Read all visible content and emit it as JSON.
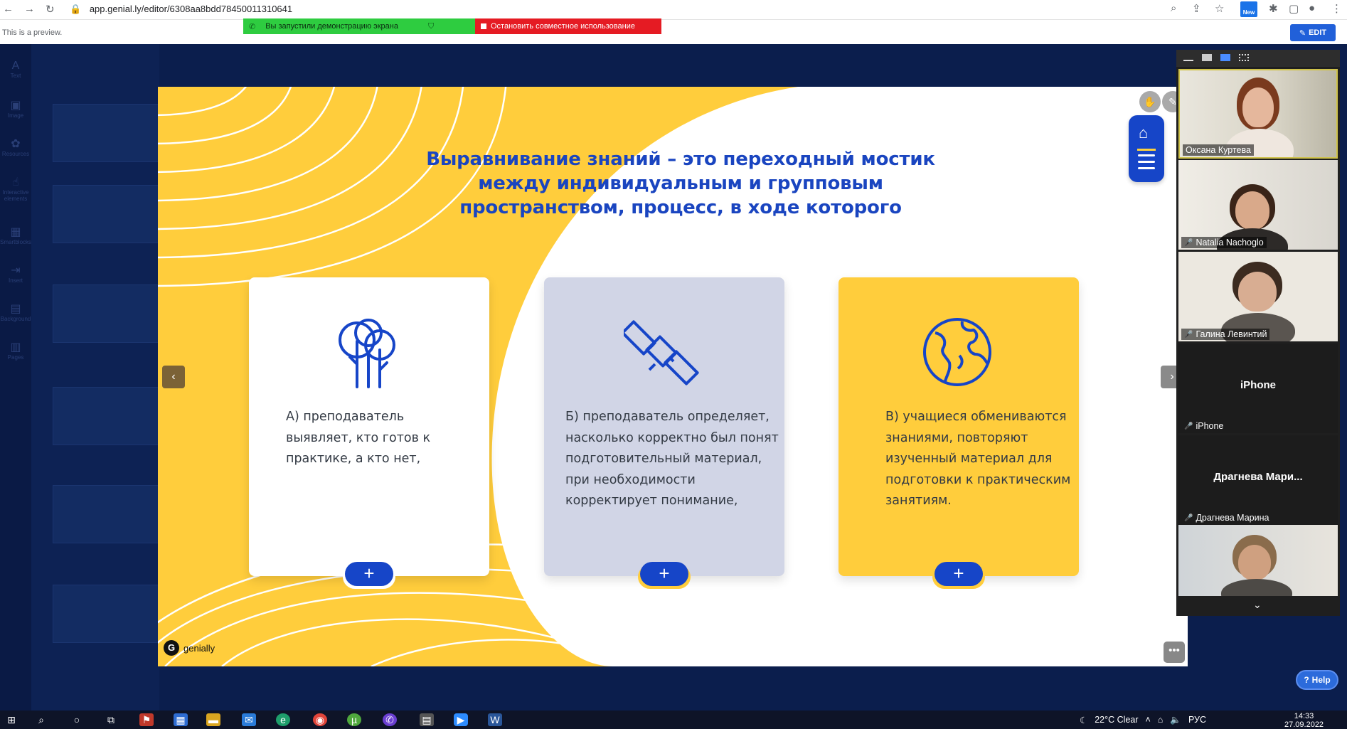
{
  "browser": {
    "url": "app.genial.ly/editor/6308aa8bdd78450011310641",
    "new_badge": "New"
  },
  "screen_share": {
    "status_text": "Вы запустили демонстрацию экрана",
    "stop_text": "Остановить совместное использование"
  },
  "preview": {
    "notice": "This is a preview.",
    "edit_label": "EDIT"
  },
  "editor_rail": [
    "Text",
    "Image",
    "Resources",
    "Interactive elements",
    "Smartblocks",
    "Insert",
    "Background",
    "Pages"
  ],
  "slide": {
    "title_lines": [
      "Выравнивание знаний – это переходный мостик",
      "между индивидуальным и групповым",
      "пространством, процесс, в ходе которого"
    ],
    "cards": [
      {
        "text": "А) преподаватель выявляет, кто готов к практике, а кто нет,",
        "icon": "trees-icon",
        "bg": "#ffffff",
        "plus": "+"
      },
      {
        "text": "Б) преподаватель определяет, насколько корректно был понят подготовительный материал, при необходимости корректирует понимание,",
        "icon": "satellite-icon",
        "bg": "#d1d5e6",
        "plus": "+"
      },
      {
        "text": "В) учащиеся обмениваются знаниями, повторяют изученный материал для подготовки к практическим занятиям.",
        "icon": "globe-icon",
        "bg": "#ffcd3c",
        "plus": "+"
      }
    ],
    "brand": "genially",
    "more": "•••"
  },
  "colors": {
    "accent_blue": "#1645c8",
    "slide_yellow": "#ffcd3c",
    "editor_navy": "#0b1e4d"
  },
  "zoom": {
    "participants": [
      {
        "name": "Оксана Куртева",
        "muted": false,
        "video": true
      },
      {
        "name": "Natalia Nachoglo",
        "muted": true,
        "video": true
      },
      {
        "name": "Галина Левинтий",
        "muted": true,
        "video": true
      },
      {
        "name": "iPhone",
        "center": "iPhone",
        "muted": true,
        "video": false
      },
      {
        "name": "Драгнева Марина",
        "center": "Драгнева Мари...",
        "muted": true,
        "video": false
      },
      {
        "name": "",
        "muted": false,
        "video": true
      }
    ]
  },
  "help": {
    "label": "Help"
  },
  "taskbar": {
    "weather": "22°C  Clear",
    "lang": "РУС",
    "time": "14:33",
    "date": "27.09.2022"
  }
}
